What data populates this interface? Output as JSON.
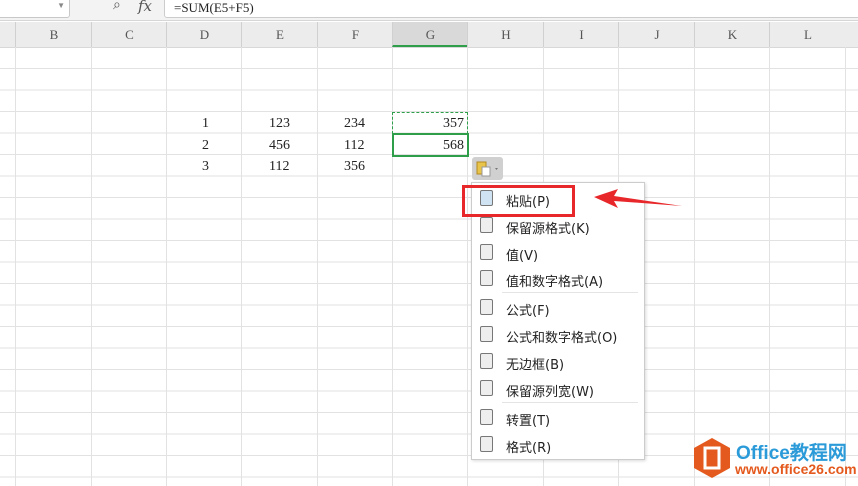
{
  "formula_bar": {
    "formula": "=SUM(E5+F5)",
    "fx_label": "fx"
  },
  "columns": [
    "B",
    "C",
    "D",
    "E",
    "F",
    "G",
    "H",
    "I",
    "J",
    "K",
    "L"
  ],
  "selected_column": "G",
  "cells": [
    {
      "d": "1",
      "e": "123",
      "f": "234",
      "g": "357"
    },
    {
      "d": "2",
      "e": "456",
      "f": "112",
      "g": "568"
    },
    {
      "d": "3",
      "e": "112",
      "f": "356",
      "g": ""
    }
  ],
  "paste_menu": {
    "items": [
      {
        "label": "粘贴(P)",
        "icon": "paste-icon"
      },
      {
        "label": "保留源格式(K)",
        "icon": "keep-source-format-icon"
      },
      {
        "label": "值(V)",
        "icon": "values-icon"
      },
      {
        "label": "值和数字格式(A)",
        "icon": "values-number-format-icon"
      },
      {
        "label": "公式(F)",
        "icon": "formula-icon"
      },
      {
        "label": "公式和数字格式(O)",
        "icon": "formula-number-format-icon"
      },
      {
        "label": "无边框(B)",
        "icon": "no-border-icon"
      },
      {
        "label": "保留源列宽(W)",
        "icon": "keep-column-width-icon"
      },
      {
        "label": "转置(T)",
        "icon": "transpose-icon"
      },
      {
        "label": "格式(R)",
        "icon": "format-icon"
      }
    ]
  },
  "watermark": {
    "title": "Office教程网",
    "url": "www.office26.com"
  },
  "colors": {
    "accent": "#2e9e4a",
    "highlight": "#e8272b",
    "logo": "#e4591d",
    "logo_text": "#2a9ad8"
  }
}
